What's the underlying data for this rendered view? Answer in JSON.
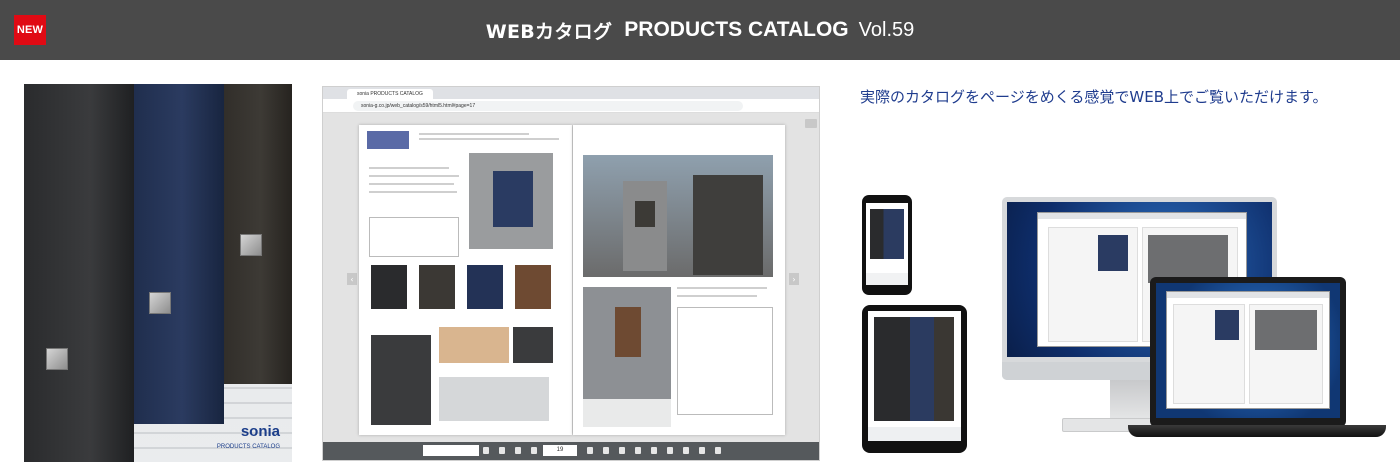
{
  "header": {
    "new_badge": "NEW",
    "title_ja": "WEBカタログ",
    "title_en": "PRODUCTS CATALOG",
    "volume": "Vol.59",
    "background": "#4a4a4a",
    "badge_color": "#e00a14"
  },
  "cover": {
    "brand": "sonia",
    "subtitle": "PRODUCTS CATALOG"
  },
  "browser": {
    "tab_label": "sonia PRODUCTS CATALOG",
    "url": "sonia-g.co.jp/web_catalog/s59/html5.html#page=17",
    "page_number": "19"
  },
  "description": {
    "text": "実際のカタログをページをめくる感覚でWEB上でご覧いただけます。",
    "color": "#1f3c8e"
  },
  "icons": [
    "new-badge",
    "chevron-left-icon",
    "chevron-right-icon",
    "search-icon",
    "menu-icon",
    "first-page-icon",
    "prev-page-icon",
    "next-page-icon",
    "last-page-icon",
    "zoom-icon",
    "print-icon",
    "download-icon",
    "pen-icon"
  ]
}
